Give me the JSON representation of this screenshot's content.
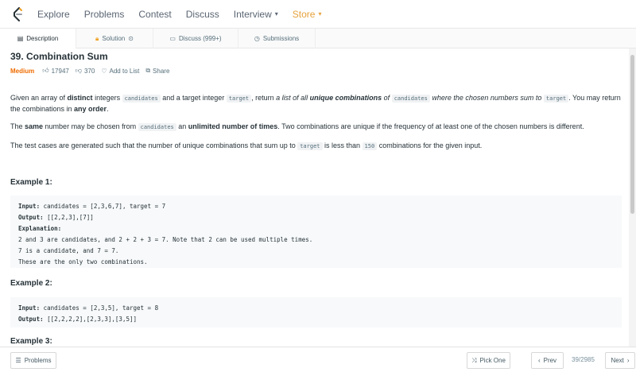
{
  "nav": {
    "items": [
      "Explore",
      "Problems",
      "Contest",
      "Discuss",
      "Interview",
      "Store"
    ]
  },
  "tabs": [
    "Description",
    "Solution",
    "Discuss (999+)",
    "Submissions"
  ],
  "problem": {
    "title": "39. Combination Sum",
    "difficulty": "Medium",
    "likes": "17947",
    "dislikes": "370",
    "add_to_list": "Add to List",
    "share": "Share"
  },
  "desc": {
    "p1a": "Given an array of ",
    "p1b": "distinct",
    "p1c": " integers ",
    "code_candidates": "candidates",
    "p1d": " and a target integer ",
    "code_target": "target",
    "p1e": ", return ",
    "p1f": "a list of all ",
    "p1g": "unique combinations",
    "p1h": " of ",
    "p1i": " where the chosen numbers sum to ",
    "p1j": ". You may return the combinations in ",
    "p1k": "any order",
    "p1l": ".",
    "p2a": "The ",
    "p2b": "same",
    "p2c": " number may be chosen from ",
    "p2d": " an ",
    "p2e": "unlimited number of times",
    "p2f": ". Two combinations are unique if the frequency of at least one of the chosen numbers is different.",
    "p3a": "The test cases are generated such that the number of unique combinations that sum up to ",
    "p3b": " is less than ",
    "code_150": "150",
    "p3c": " combinations for the given input."
  },
  "examples": [
    {
      "title": "Example 1:",
      "input_label": "Input:",
      "input": " candidates = [2,3,6,7], target = 7",
      "output_label": "Output:",
      "output": " [[2,2,3],[7]]",
      "explanation_label": "Explanation:",
      "explanation": [
        "2 and 3 are candidates, and 2 + 2 + 3 = 7. Note that 2 can be used multiple times.",
        "7 is a candidate, and 7 = 7.",
        "These are the only two combinations."
      ]
    },
    {
      "title": "Example 2:",
      "input_label": "Input:",
      "input": " candidates = [2,3,5], target = 8",
      "output_label": "Output:",
      "output": " [[2,2,2,2],[2,3,3],[3,5]]"
    },
    {
      "title": "Example 3:"
    }
  ],
  "bottom": {
    "problems": "Problems",
    "pick_one": "Pick One",
    "prev": "Prev",
    "page": "39/2985",
    "next": "Next"
  }
}
